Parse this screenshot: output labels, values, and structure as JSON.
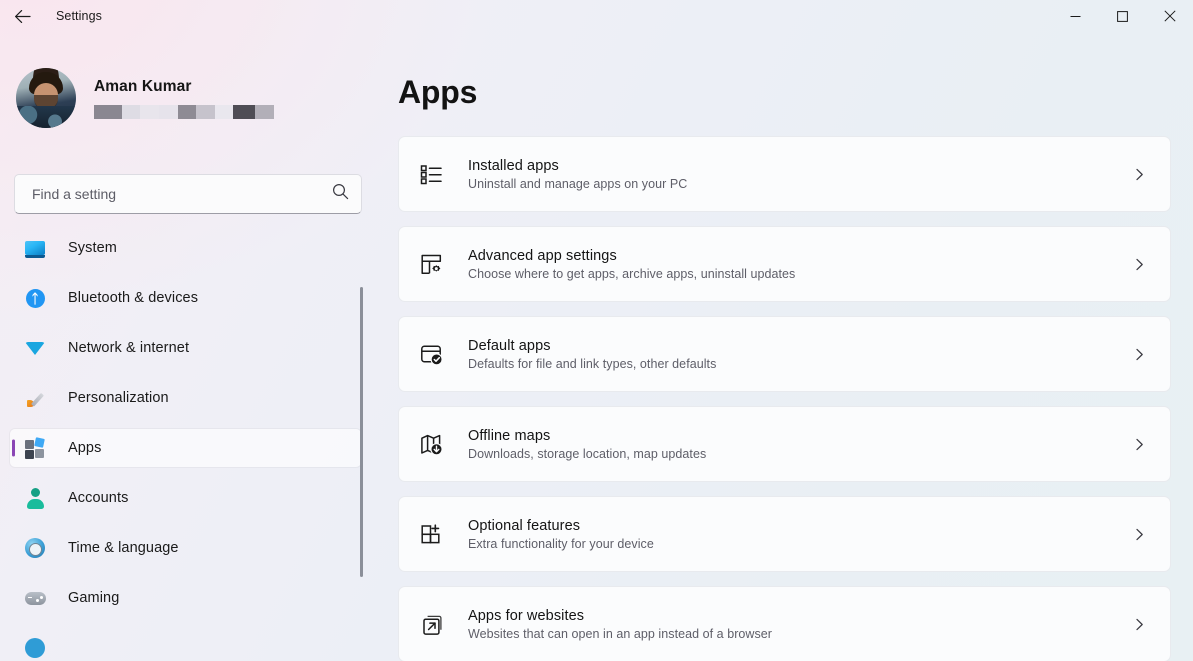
{
  "window": {
    "app_title": "Settings",
    "back_label": "Back",
    "controls": {
      "minimize": "Minimize",
      "maximize": "Maximize",
      "close": "Close"
    }
  },
  "account": {
    "name": "Aman Kumar",
    "email_redacted": true
  },
  "search": {
    "placeholder": "Find a setting",
    "value": "",
    "icon": "search-icon"
  },
  "sidebar": {
    "active_index": 4,
    "accent_color": "#8b46b5",
    "items": [
      {
        "label": "System",
        "icon": "monitor-icon",
        "key": "system"
      },
      {
        "label": "Bluetooth & devices",
        "icon": "bluetooth-icon",
        "key": "bluetooth"
      },
      {
        "label": "Network & internet",
        "icon": "wifi-icon",
        "key": "network"
      },
      {
        "label": "Personalization",
        "icon": "paintbrush-icon",
        "key": "personalization"
      },
      {
        "label": "Apps",
        "icon": "apps-grid-icon",
        "key": "apps"
      },
      {
        "label": "Accounts",
        "icon": "person-icon",
        "key": "accounts"
      },
      {
        "label": "Time & language",
        "icon": "clock-globe-icon",
        "key": "time"
      },
      {
        "label": "Gaming",
        "icon": "gamepad-icon",
        "key": "gaming"
      },
      {
        "label": "",
        "icon": "accessibility-icon",
        "key": "accessibility"
      }
    ]
  },
  "main": {
    "title": "Apps",
    "cards": [
      {
        "title": "Installed apps",
        "subtitle": "Uninstall and manage apps on your PC",
        "icon": "list-bullets-icon",
        "key": "installed-apps"
      },
      {
        "title": "Advanced app settings",
        "subtitle": "Choose where to get apps, archive apps, uninstall updates",
        "icon": "layout-gear-icon",
        "key": "advanced-app-settings"
      },
      {
        "title": "Default apps",
        "subtitle": "Defaults for file and link types, other defaults",
        "icon": "window-check-icon",
        "key": "default-apps"
      },
      {
        "title": "Offline maps",
        "subtitle": "Downloads, storage location, map updates",
        "icon": "map-download-icon",
        "key": "offline-maps"
      },
      {
        "title": "Optional features",
        "subtitle": "Extra functionality for your device",
        "icon": "grid-plus-icon",
        "key": "optional-features"
      },
      {
        "title": "Apps for websites",
        "subtitle": "Websites that can open in an app instead of a browser",
        "icon": "external-link-icon",
        "key": "apps-for-websites"
      }
    ],
    "chevron_icon": "chevron-right-icon"
  }
}
